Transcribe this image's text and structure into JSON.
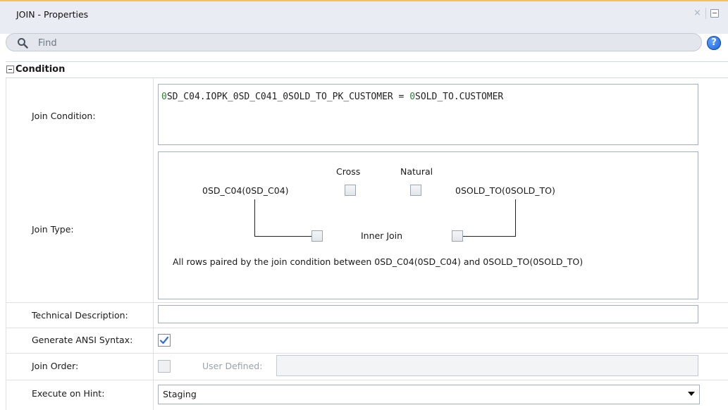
{
  "window": {
    "title": "JOIN - Properties",
    "close_glyph": "×"
  },
  "search": {
    "placeholder": "Find"
  },
  "help": {
    "glyph": "?"
  },
  "section": {
    "title": "Condition"
  },
  "labels": {
    "join_condition": "Join Condition:",
    "join_type": "Join Type:",
    "technical_description": "Technical Description:",
    "generate_ansi": "Generate ANSI Syntax:",
    "join_order": "Join Order:",
    "execute_on_hint": "Execute on Hint:"
  },
  "join_condition": {
    "left_prefix": "0",
    "left_rest": "SD_C04.IOPK_0SD_C041_0SOLD_TO_PK_CUSTOMER = ",
    "right_prefix": "0",
    "right_rest": "SOLD_TO.CUSTOMER"
  },
  "join_type": {
    "left_table": "0SD_C04(0SD_C04)",
    "right_table": "0SOLD_TO(0SOLD_TO)",
    "cross_label": "Cross",
    "natural_label": "Natural",
    "inner_join_label": "Inner Join",
    "description": "All rows paired by the join condition between 0SD_C04(0SD_C04) and 0SOLD_TO(0SOLD_TO)",
    "cross_checked": false,
    "natural_checked": false,
    "left_outer_checked": false,
    "right_outer_checked": false
  },
  "technical_description": {
    "value": ""
  },
  "generate_ansi": {
    "checked": true,
    "check_glyph": "✔"
  },
  "join_order": {
    "checked": false,
    "user_defined_label": "User Defined:",
    "user_defined_value": ""
  },
  "execute_on_hint": {
    "value": "Staging"
  },
  "colors": {
    "accent": "#f2c06a",
    "check": "#2f6fd6",
    "green_text": "#2e7d32"
  }
}
